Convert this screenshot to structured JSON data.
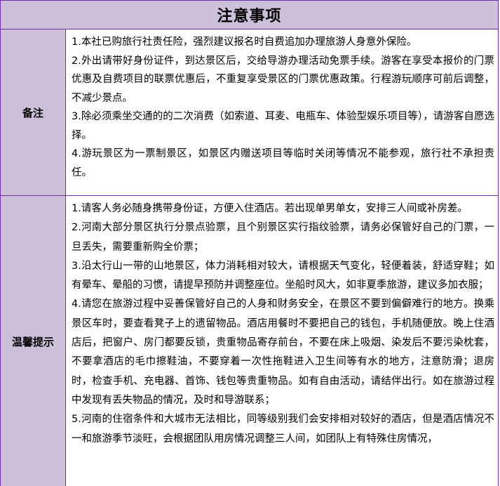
{
  "title": "注意事项",
  "remarks": {
    "label": "备注",
    "items": [
      "1.本社已购旅行社责任险，强烈建议报名时自费追加办理旅游人身意外保险。",
      "2.外出请带好身份证件，到达景区后，交给导游办理活动免票手续。游客在享受本报价的门票优惠及自费项目的联票优惠后，不重复享受景区的门票优惠政策。行程游玩顺序可前后调整，不减少景点。",
      "3.除必须乘坐交通的的二次消费（如索道、耳麦、电瓶车、体验型娱乐项目等），请游客自愿选择。",
      "4.游玩景区为一票制景区，如景区内赠送项目等临时关闭等情况不能参观，旅行社不承担责任。"
    ]
  },
  "tips": {
    "label": "温馨提示",
    "items": [
      "1.请客人务必随身携带身份证，方便入住酒店。若出现单男单女，安排三人间或补房差。",
      "2.河南大部分景区执行分景点验票，且个别景区实行指纹验票，请务必保管好自己的门票，一旦丢失，需要重新购全价票；",
      "3.沿太行山一带的山地景区，体力消耗相对较大，请根据天气变化，轻便着装，舒适穿鞋；如有晕车、晕船的习惯，请提早预防并调整座位。坐船时风大，如非夏季旅游，建议多加衣服；",
      "4.请您在旅游过程中妥善保管好自己的人身和财务安全，在景区不要到偏僻难行的地方。换乘景区车时，要查看凳子上的遗留物品。酒店用餐时不要把自己的钱包，手机随便放。晚上住酒店后，把窗户、房门都要反锁，贵重物品寄存前台，不要在床上吸烟、染发后不要污染枕套，不要拿酒店的毛巾擦鞋油，不要穿着一次性拖鞋进入卫生间等有水的地方，注意防滑；退房时，检查手机、充电器、首饰、钱包等贵重物品。如有自由活动，请结伴出行。如在旅游过程中发现有丢失物品的情况，及时和导游联系；",
      "5.河南的住宿条件和大城市无法相比，同等级别我们会安排相对较好的酒店，但是酒店情况不一和旅游季节淡旺，会根据团队用房情况调整三人间，如团队上有特殊住房情况，"
    ]
  },
  "colors": {
    "header_bg": "#ccc0da",
    "border": "#7030a0"
  }
}
